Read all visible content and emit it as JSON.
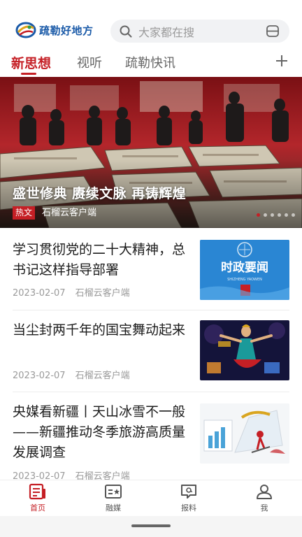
{
  "header": {
    "logo_text": "疏勒好地方",
    "search_placeholder": "大家都在搜"
  },
  "tabs": [
    {
      "label": "新思想"
    },
    {
      "label": "视听"
    },
    {
      "label": "疏勒快讯"
    }
  ],
  "banner": {
    "title": "盛世修典 赓续文脉 再铸辉煌",
    "badge": "热文",
    "source": "石榴云客户端"
  },
  "news": [
    {
      "title": "学习贯彻党的二十大精神，总书记这样指导部署",
      "date": "2023-02-07",
      "source": "石榴云客户端",
      "thumb_text": "时政要闻",
      "thumb_sub": "SHIZHENG YAOWEN"
    },
    {
      "title": "当尘封两千年的国宝舞动起来",
      "date": "2023-02-07",
      "source": "石榴云客户端"
    },
    {
      "title": "央媒看新疆丨天山冰雪不一般——新疆推动冬季旅游高质量发展调查",
      "date": "2023-02-07",
      "source": "石榴云客户端"
    }
  ],
  "bottom_nav": [
    {
      "label": "首页",
      "icon": "home-news-icon",
      "active": true
    },
    {
      "label": "融媒",
      "icon": "media-card-icon",
      "active": false
    },
    {
      "label": "报料",
      "icon": "report-chat-icon",
      "active": false
    },
    {
      "label": "我",
      "icon": "profile-icon",
      "active": false
    }
  ],
  "colors": {
    "accent": "#c51f25",
    "logo_blue": "#1a5aa8",
    "meta_gray": "#9a9a9a"
  }
}
